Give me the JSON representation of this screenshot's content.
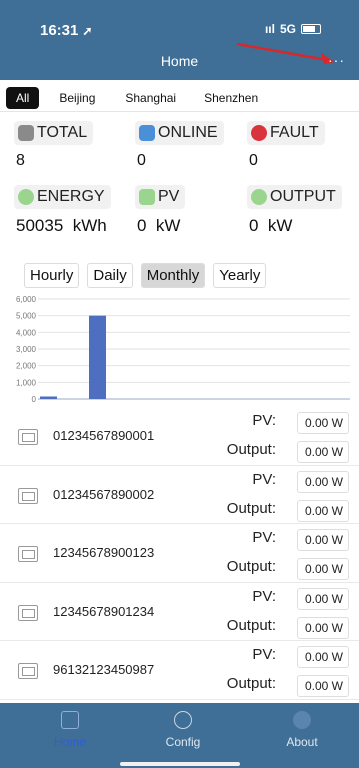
{
  "status_bar": {
    "time": "16:31",
    "signal": "5G"
  },
  "header": {
    "title": "Home",
    "menu": "···"
  },
  "tabs": [
    {
      "label": "All",
      "active": true
    },
    {
      "label": "Beijing"
    },
    {
      "label": "Shanghai"
    },
    {
      "label": "Shenzhen"
    }
  ],
  "stats": {
    "total": {
      "label": "TOTAL",
      "value": "8"
    },
    "online": {
      "label": "ONLINE",
      "value": "0"
    },
    "fault": {
      "label": "FAULT",
      "value": "0"
    },
    "energy": {
      "label": "ENERGY",
      "value": "50035",
      "unit": "kWh"
    },
    "pv": {
      "label": "PV",
      "value": "0",
      "unit": "kW"
    },
    "output": {
      "label": "OUTPUT",
      "value": "0",
      "unit": "kW"
    }
  },
  "periods": [
    {
      "label": "Hourly"
    },
    {
      "label": "Daily"
    },
    {
      "label": "Monthly",
      "active": true
    },
    {
      "label": "Yearly"
    }
  ],
  "chart_data": {
    "type": "bar",
    "y_ticks": [
      "6,000",
      "5,000",
      "4,000",
      "3,000",
      "2,000",
      "1,000",
      "0"
    ],
    "ylim": [
      0,
      6000
    ],
    "values": [
      150,
      5000
    ],
    "grid": true,
    "bar_color": "#4e6fbf"
  },
  "devices": [
    {
      "id": "01234567890001",
      "pv_label": "PV:",
      "pv": "0.00 W",
      "out_label": "Output:",
      "out": "0.00 W"
    },
    {
      "id": "01234567890002",
      "pv_label": "PV:",
      "pv": "0.00 W",
      "out_label": "Output:",
      "out": "0.00 W"
    },
    {
      "id": "12345678900123",
      "pv_label": "PV:",
      "pv": "0.00 W",
      "out_label": "Output:",
      "out": "0.00 W"
    },
    {
      "id": "12345678901234",
      "pv_label": "PV:",
      "pv": "0.00 W",
      "out_label": "Output:",
      "out": "0.00 W"
    },
    {
      "id": "96132123450987",
      "pv_label": "PV:",
      "pv": "0.00 W",
      "out_label": "Output:",
      "out": "0.00 W"
    }
  ],
  "tabbar": [
    {
      "label": "Home",
      "icon": "home-icon",
      "active": true
    },
    {
      "label": "Config",
      "icon": "globe-icon"
    },
    {
      "label": "About",
      "icon": "info-icon"
    }
  ],
  "colors": {
    "header": "#3f6e96",
    "accent": "#4e6fbf"
  }
}
